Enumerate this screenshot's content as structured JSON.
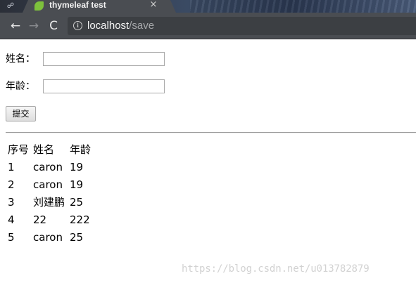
{
  "browser": {
    "tab": {
      "title": "thymeleaf test",
      "close_glyph": "×"
    },
    "profile_glyph": "☍",
    "nav": {
      "back_glyph": "←",
      "forward_glyph": "→",
      "reload_glyph": "C"
    },
    "address": {
      "info_glyph": "i",
      "host": "localhost",
      "path": "/save"
    }
  },
  "form": {
    "name_label": "姓名：",
    "name_value": "",
    "age_label": "年龄：",
    "age_value": "",
    "submit_label": "提交"
  },
  "table": {
    "headers": [
      "序号",
      "姓名",
      "年龄"
    ],
    "rows": [
      [
        "1",
        "caron",
        "19"
      ],
      [
        "2",
        "caron",
        "19"
      ],
      [
        "3",
        "刘建鹏",
        "25"
      ],
      [
        "4",
        "22",
        "222"
      ],
      [
        "5",
        "caron",
        "25"
      ]
    ]
  },
  "watermark": "https://blog.csdn.net/u013782879",
  "colors": {
    "favicon": "#7ec13c",
    "chrome": "#4a4d52"
  },
  "icons": {
    "profile": "profile-switcher-icon",
    "favicon": "leaf-icon",
    "close": "close-icon",
    "back": "back-arrow-icon",
    "forward": "forward-arrow-icon",
    "reload": "reload-icon",
    "info": "info-icon"
  }
}
